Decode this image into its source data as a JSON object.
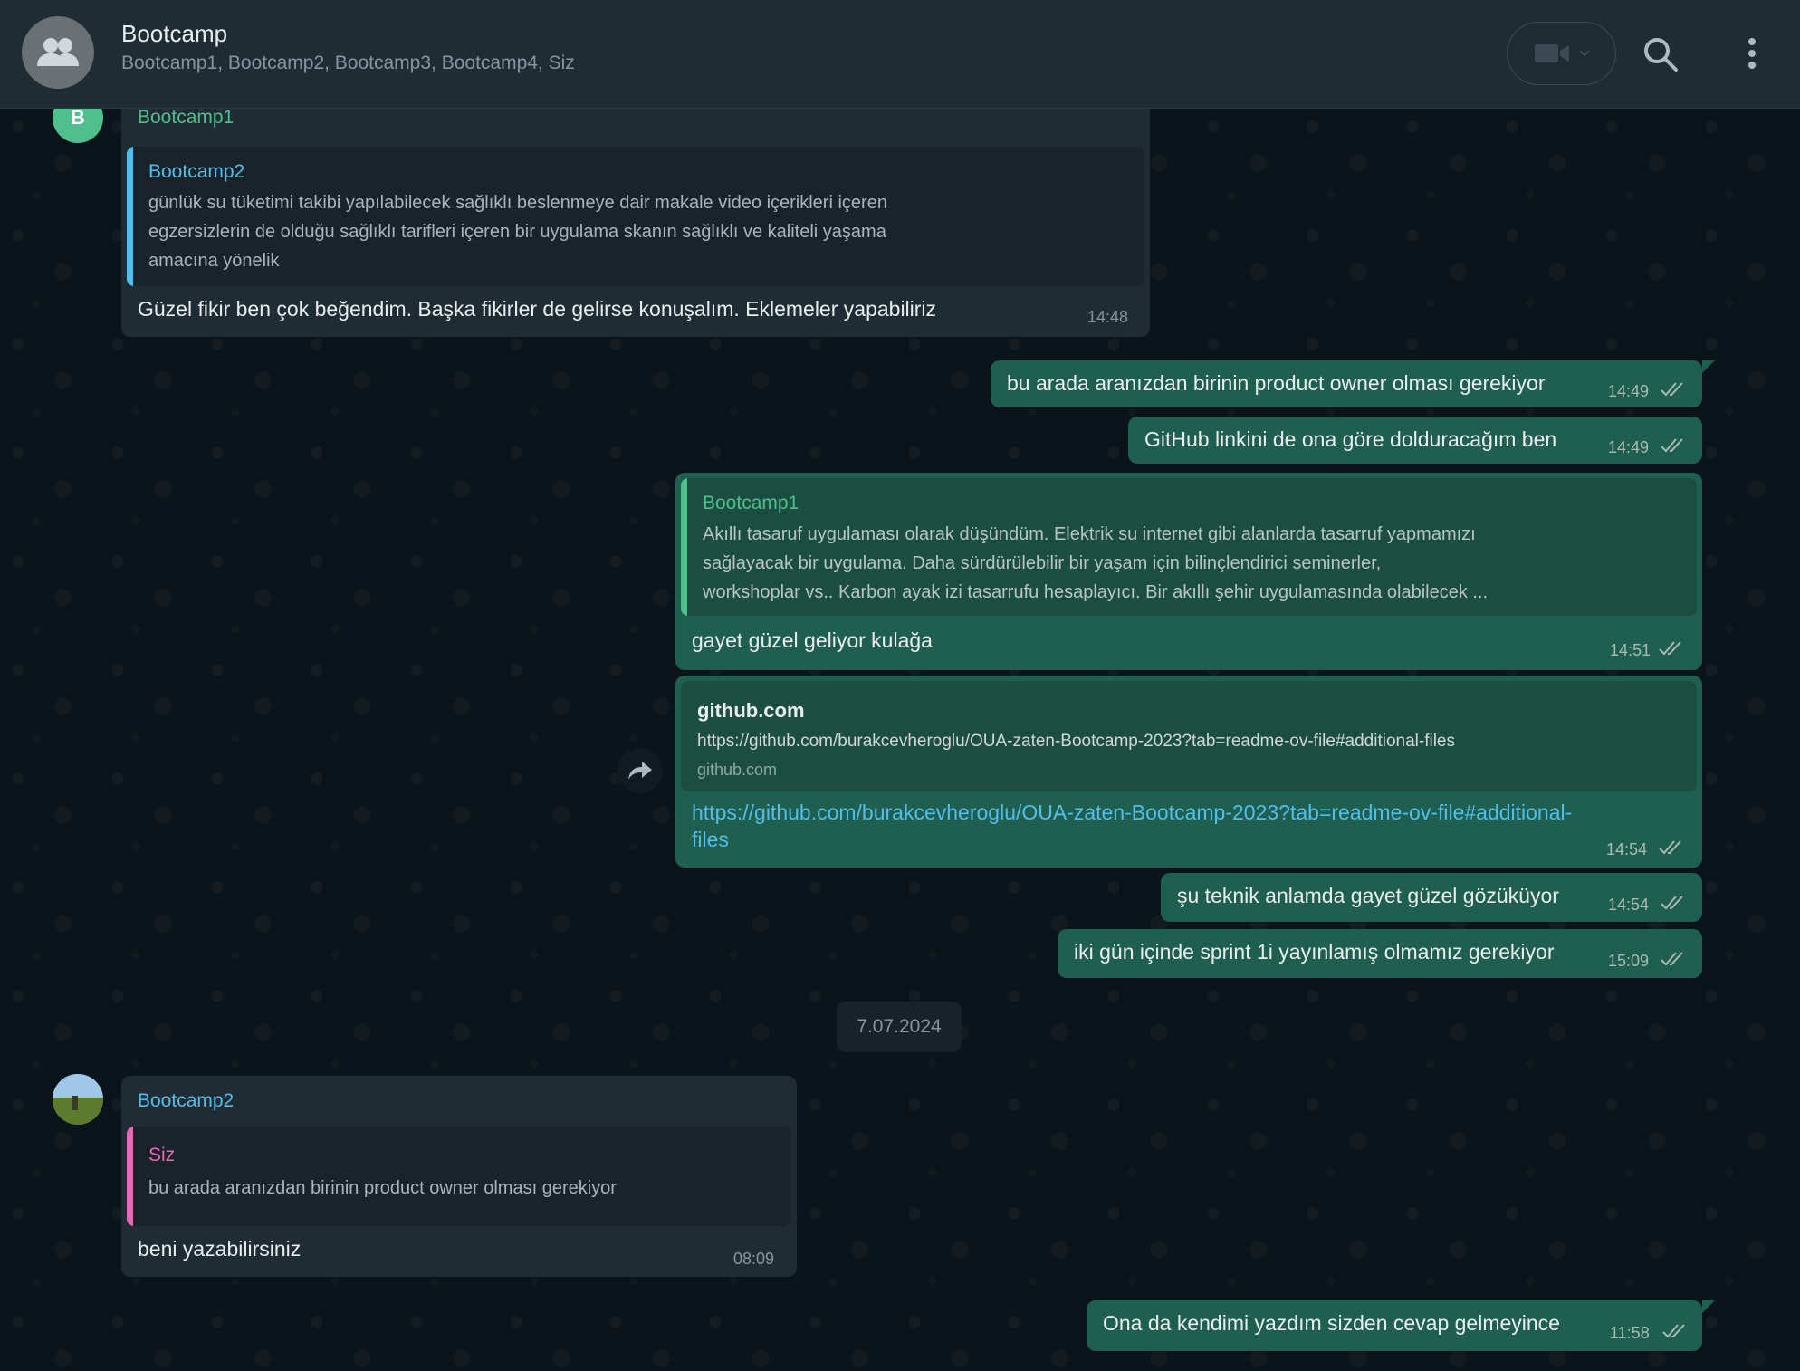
{
  "header": {
    "title": "Bootcamp",
    "subtitle": "Bootcamp1, Bootcamp2, Bootcamp3, Bootcamp4, Siz"
  },
  "avatars": {
    "bootcamp1_initial": "B"
  },
  "messages": {
    "m1": {
      "sender": "Bootcamp1",
      "quote_name": "Bootcamp2",
      "quote_lines": [
        "günlük su tüketimi takibi yapılabilecek sağlıklı beslenmeye dair makale video içerikleri içeren",
        "egzersizlerin de olduğu sağlıklı tarifleri içeren bir uygulama skanın sağlıklı ve kaliteli yaşama",
        "amacına yönelik"
      ],
      "text": "Güzel fikir ben çok beğendim. Başka fikirler de gelirse konuşalım. Eklemeler yapabiliriz",
      "time": "14:48"
    },
    "m2": {
      "text": "bu arada aranızdan birinin product owner olması gerekiyor",
      "time": "14:49"
    },
    "m3": {
      "text": "GitHub linkini de ona göre dolduracağım ben",
      "time": "14:49"
    },
    "m4": {
      "quote_name": "Bootcamp1",
      "quote_lines": [
        "Akıllı tasaruf uygulaması olarak düşündüm. Elektrik su internet gibi alanlarda tasarruf yapmamızı",
        "sağlayacak bir uygulama. Daha sürdürülebilir bir yaşam için bilinçlendirici seminerler,",
        "workshoplar vs.. Karbon ayak izi tasarrufu hesaplayıcı. Bir akıllı şehir uygulamasında olabilecek ..."
      ],
      "text": "gayet güzel geliyor kulağa",
      "time": "14:51"
    },
    "m5": {
      "preview_title": "github.com",
      "preview_url": "https://github.com/burakcevheroglu/OUA-zaten-Bootcamp-2023?tab=readme-ov-file#additional-files",
      "preview_domain": "github.com",
      "link_line1": "https://github.com/burakcevheroglu/OUA-zaten-Bootcamp-2023?tab=readme-ov-file#additional-",
      "link_line2": "files",
      "time": "14:54"
    },
    "m6": {
      "text": "şu teknik anlamda gayet güzel gözüküyor",
      "time": "14:54"
    },
    "m7": {
      "text": "iki gün içinde sprint 1i yayınlamış olmamız gerekiyor",
      "time": "15:09"
    },
    "date_divider": "7.07.2024",
    "m8": {
      "sender": "Bootcamp2",
      "quote_name": "Siz",
      "quote_text": "bu arada aranızdan birinin product owner olması gerekiyor",
      "text": "beni yazabilirsiniz",
      "time": "08:09"
    },
    "m9": {
      "text": "Ona da kendimi yazdım sizden cevap gelmeyince",
      "time": "11:58"
    }
  },
  "colors": {
    "header_bg": "#202c33",
    "chat_bg": "#0b141a",
    "incoming_bubble": "#202c33",
    "outgoing_bubble": "#1f5f4f",
    "bootcamp1_name": "#53bdeb",
    "bootcamp2_name": "#53bdeb",
    "siz_name": "#e26ab6",
    "read_ticks": "#a9bbb5"
  }
}
